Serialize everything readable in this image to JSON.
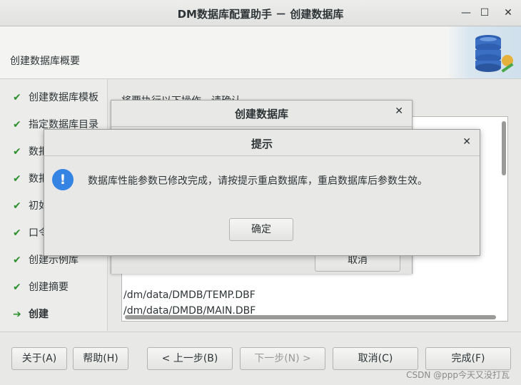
{
  "window": {
    "title": "DM数据库配置助手 － 创建数据库",
    "min_symbol": "—",
    "max_symbol": "☐",
    "close_symbol": "✕"
  },
  "header": {
    "title": "创建数据库概要"
  },
  "sidebar": {
    "items": [
      {
        "label": "创建数据库模板",
        "icon": "check-icon"
      },
      {
        "label": "指定数据库目录",
        "icon": "check-icon"
      },
      {
        "label": "数拒",
        "icon": "check-icon"
      },
      {
        "label": "数拒",
        "icon": "check-icon"
      },
      {
        "label": "初如",
        "icon": "check-icon"
      },
      {
        "label": "口令",
        "icon": "check-icon"
      },
      {
        "label": "创建示例库",
        "icon": "check-icon"
      },
      {
        "label": "创建摘要",
        "icon": "check-icon"
      },
      {
        "label": "创建",
        "icon": "arrow-right-icon"
      }
    ],
    "check_symbol": "✔",
    "arrow_symbol": "➔"
  },
  "content": {
    "intro": "将要执行以下操作，请确认",
    "log_lines": [
      "/dm/data/DMDB/TEMP.DBF",
      "/dm/data/DMDB/MAIN.DBF"
    ]
  },
  "create_dialog": {
    "title": "创建数据库",
    "close_symbol": "✕",
    "cancel_label": "取消"
  },
  "alert_dialog": {
    "title": "提示",
    "close_symbol": "✕",
    "icon_symbol": "!",
    "message": "数据库性能参数已修改完成，请按提示重启数据库，重启数据库后参数生效。",
    "ok_label": "确定"
  },
  "footer": {
    "about_label": "关于(A)",
    "help_label": "帮助(H)",
    "prev_label": "< 上一步(B)",
    "next_label": "下一步(N) >",
    "cancel_label": "取消(C)",
    "finish_label": "完成(F)",
    "watermark": "CSDN @ppp今天又没打瓦"
  },
  "colors": {
    "accent": "#3584e4",
    "check": "#2d8f2d"
  }
}
